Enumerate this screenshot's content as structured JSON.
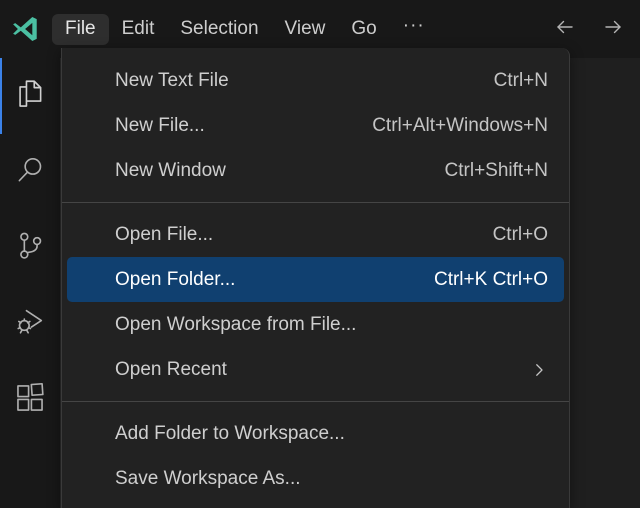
{
  "titlebar": {
    "logo_icon": "vscode-logo-icon",
    "logo_color": "#4bbfa2",
    "menus": [
      {
        "label": "File",
        "active": true
      },
      {
        "label": "Edit",
        "active": false
      },
      {
        "label": "Selection",
        "active": false
      },
      {
        "label": "View",
        "active": false
      },
      {
        "label": "Go",
        "active": false
      }
    ],
    "overflow_label": "···",
    "nav": {
      "back_icon": "arrow-left-icon",
      "forward_icon": "arrow-right-icon"
    }
  },
  "activitybar": {
    "items": [
      {
        "name": "explorer",
        "icon": "files-icon",
        "active": true
      },
      {
        "name": "search",
        "icon": "search-icon",
        "active": false
      },
      {
        "name": "source-control",
        "icon": "source-control-icon",
        "active": false
      },
      {
        "name": "run-and-debug",
        "icon": "run-and-debug-icon",
        "active": false
      },
      {
        "name": "extensions",
        "icon": "extensions-icon",
        "active": false
      }
    ],
    "active_indicator_color": "#3b82e8"
  },
  "file_menu": {
    "highlight_color": "#104070",
    "groups": [
      {
        "items": [
          {
            "label": "New Text File",
            "shortcut": "Ctrl+N",
            "selected": false,
            "submenu": false
          },
          {
            "label": "New File...",
            "shortcut": "Ctrl+Alt+Windows+N",
            "selected": false,
            "submenu": false
          },
          {
            "label": "New Window",
            "shortcut": "Ctrl+Shift+N",
            "selected": false,
            "submenu": false
          }
        ]
      },
      {
        "items": [
          {
            "label": "Open File...",
            "shortcut": "Ctrl+O",
            "selected": false,
            "submenu": false
          },
          {
            "label": "Open Folder...",
            "shortcut": "Ctrl+K Ctrl+O",
            "selected": true,
            "submenu": false
          },
          {
            "label": "Open Workspace from File...",
            "shortcut": "",
            "selected": false,
            "submenu": false
          },
          {
            "label": "Open Recent",
            "shortcut": "",
            "selected": false,
            "submenu": true
          }
        ]
      },
      {
        "items": [
          {
            "label": "Add Folder to Workspace...",
            "shortcut": "",
            "selected": false,
            "submenu": false
          },
          {
            "label": "Save Workspace As...",
            "shortcut": "",
            "selected": false,
            "submenu": false
          }
        ]
      }
    ]
  }
}
